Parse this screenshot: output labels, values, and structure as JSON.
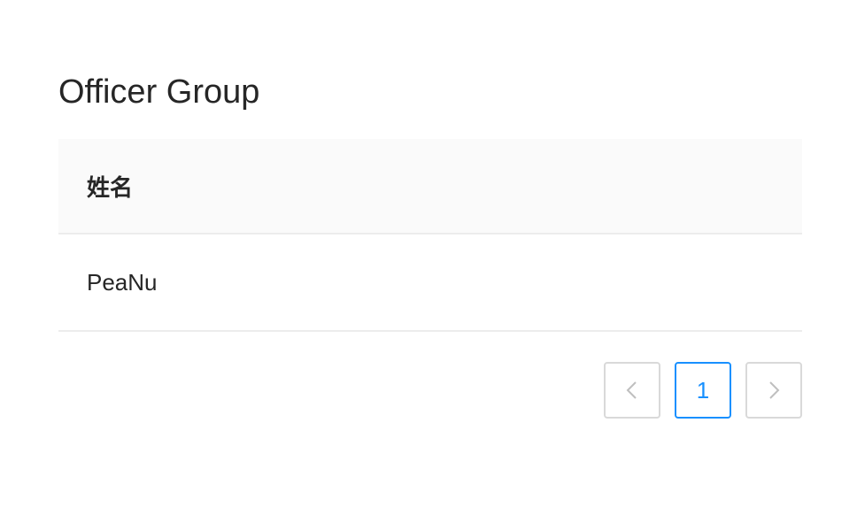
{
  "page": {
    "title": "Officer Group"
  },
  "table": {
    "columns": [
      "姓名"
    ],
    "rows": [
      [
        "PeaNu"
      ]
    ]
  },
  "pagination": {
    "prev_icon": "chevron-left-icon",
    "next_icon": "chevron-right-icon",
    "pages": [
      "1"
    ],
    "current": "1"
  },
  "colors": {
    "accent": "#1890ff",
    "header_bg": "#fafafa",
    "border": "#d9d9d9"
  }
}
